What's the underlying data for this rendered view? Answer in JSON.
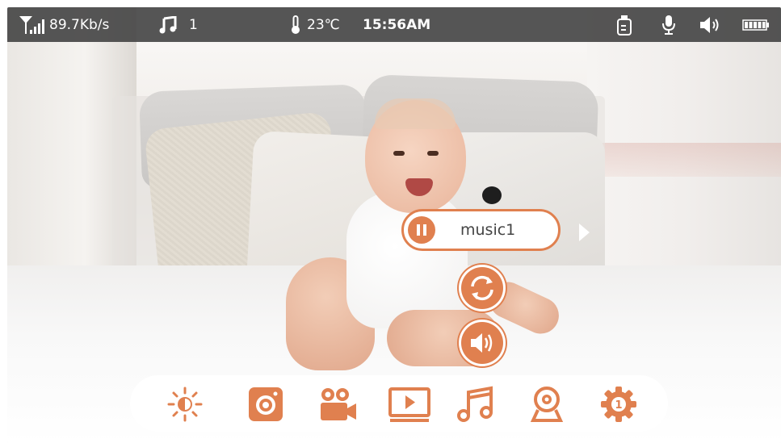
{
  "status_bar": {
    "signal_icon": "signal-bars-icon",
    "speed": "89.7Kb/s",
    "music_icon": "music-note-icon",
    "music_count": "1",
    "thermometer_icon": "thermometer-icon",
    "temperature": "23℃",
    "time": "15:56AM",
    "right_icons": [
      "feeding-bottle-icon",
      "microphone-icon",
      "speaker-volume-icon",
      "battery-icon"
    ]
  },
  "music_player": {
    "track": "music1",
    "pause_icon": "pause-icon",
    "next_icon": "next-arrow-icon",
    "repeat_icon": "repeat-icon",
    "volume_icon": "volume-icon"
  },
  "toolbar": {
    "items": [
      "brightness-icon",
      "snapshot-icon",
      "video-record-icon",
      "playback-icon",
      "music-icon",
      "camera-select-icon",
      "settings-icon"
    ],
    "settings_badge": "1"
  },
  "colors": {
    "accent": "#e0804f",
    "status_bar_bg": "#464646",
    "toolbar_bg": "#ffffff"
  }
}
